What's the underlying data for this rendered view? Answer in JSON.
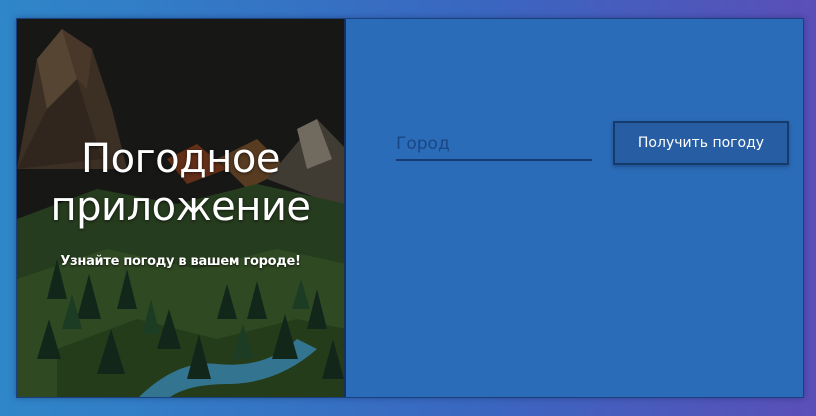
{
  "hero": {
    "title_line1": "Погодное",
    "title_line2": "приложение",
    "subtitle": "Узнайте погоду в вашем городе!",
    "image": "low-poly-mountain-forest-landscape"
  },
  "form": {
    "city_placeholder": "Город",
    "city_value": "",
    "submit_label": "Получить погоду"
  },
  "colors": {
    "background_left": "#2f86c9",
    "background_right": "#5a4fb8",
    "panel": "#2b6cb8",
    "button": "#275ea3",
    "border": "#163a73"
  }
}
